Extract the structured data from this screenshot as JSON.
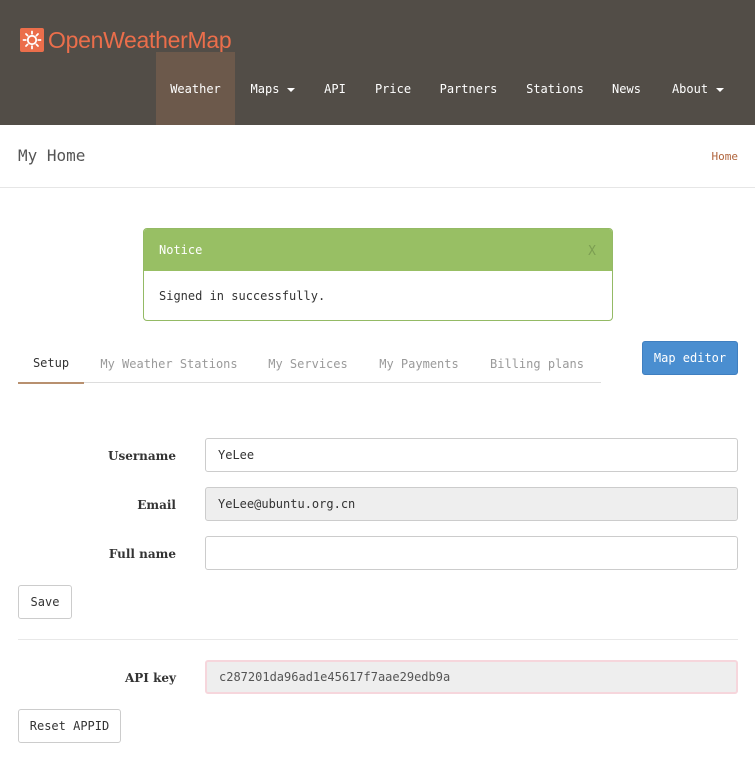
{
  "brand": {
    "name": "OpenWeatherMap",
    "icon": "sun-logo-icon",
    "color": "#eb6e4b"
  },
  "nav": {
    "items": [
      {
        "label": "Weather",
        "active": true
      },
      {
        "label": "Maps",
        "dropdown": true
      },
      {
        "label": "API"
      },
      {
        "label": "Price"
      },
      {
        "label": "Partners"
      },
      {
        "label": "Stations"
      },
      {
        "label": "News"
      },
      {
        "label": "About",
        "dropdown": true
      }
    ]
  },
  "page": {
    "title": "My Home",
    "breadcrumb": "Home"
  },
  "notice": {
    "title": "Notice",
    "close_label": "X",
    "message": "Signed in successfully."
  },
  "tabs": [
    {
      "label": "Setup",
      "active": true
    },
    {
      "label": "My Weather Stations"
    },
    {
      "label": "My Services"
    },
    {
      "label": "My Payments"
    },
    {
      "label": "Billing plans"
    }
  ],
  "map_editor_label": "Map editor",
  "form": {
    "username_label": "Username",
    "username_value": "YeLee",
    "email_label": "Email",
    "email_value": "YeLee@ubuntu.org.cn",
    "fullname_label": "Full name",
    "fullname_value": "",
    "save_label": "Save",
    "apikey_label": "API key",
    "apikey_value": "c287201da96ad1e45617f7aae29edb9a",
    "reset_label": "Reset APPID"
  },
  "colors": {
    "header_bg": "#524d47",
    "nav_active_bg": "#6c594b",
    "notice_green": "#98bf64",
    "primary_blue": "#4a8ed0",
    "breadcrumb_link": "#b0643c"
  }
}
